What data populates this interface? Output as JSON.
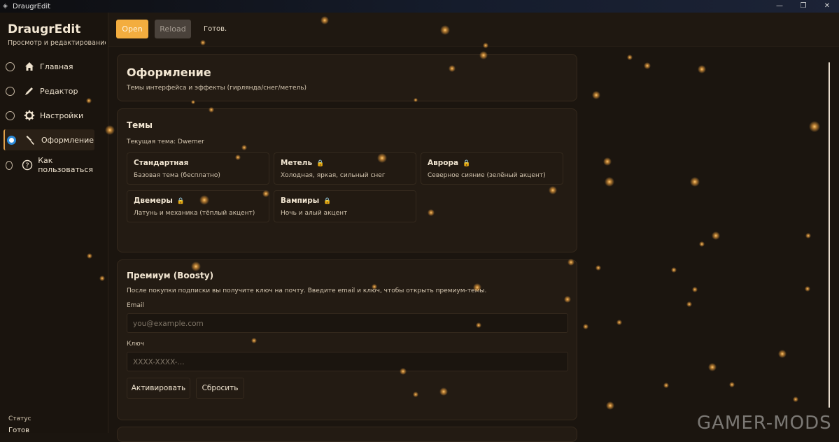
{
  "window": {
    "title": "DraugrEdit",
    "controls": [
      "—",
      "❐",
      "✕"
    ]
  },
  "sidebar": {
    "brand": "DraugrEdit",
    "subtitle": "Просмотр и редактирование ст",
    "items": [
      {
        "label": "Главная",
        "icon": "home-icon",
        "selected": false
      },
      {
        "label": "Редактор",
        "icon": "pencil-icon",
        "selected": false
      },
      {
        "label": "Настройки",
        "icon": "gear-icon",
        "selected": false
      },
      {
        "label": "Оформление",
        "icon": "brush-icon",
        "selected": true
      },
      {
        "label": "Как пользоваться",
        "icon": "help-icon",
        "selected": false
      }
    ],
    "status_label": "Статус",
    "status_value": "Готов"
  },
  "toolbar": {
    "open_label": "Open",
    "reload_label": "Reload",
    "status": "Готов."
  },
  "header_card": {
    "title": "Оформление",
    "subtitle": "Темы интерфейса и эффекты (гирлянда/снег/метель)"
  },
  "themes": {
    "title": "Темы",
    "current": "Текущая тема: Dwemer",
    "items": [
      {
        "name": "Стандартная",
        "desc": "Базовая тема (бесплатно)",
        "locked": false
      },
      {
        "name": "Метель",
        "desc": "Холодная, яркая, сильный снег",
        "locked": true
      },
      {
        "name": "Аврора",
        "desc": "Северное сияние (зелёный акцент)",
        "locked": true
      },
      {
        "name": "Двемеры",
        "desc": "Латунь и механика (тёплый акцент)",
        "locked": true
      },
      {
        "name": "Вампиры",
        "desc": "Ночь и алый акцент",
        "locked": true
      }
    ]
  },
  "premium": {
    "title": "Премиум (Boosty)",
    "desc": "После покупки подписки вы получите ключ на почту. Введите email и ключ, чтобы открыть премиум-темы.",
    "email_label": "Email",
    "email_placeholder": "you@example.com",
    "key_label": "Ключ",
    "key_placeholder": "XXXX-XXXX-...",
    "activate_label": "Активировать",
    "reset_label": "Сбросить"
  },
  "watermark": "GAMER-MODS",
  "colors": {
    "accent": "#f3ad3f",
    "spark": "#f5a640",
    "background": "#1b150f"
  }
}
